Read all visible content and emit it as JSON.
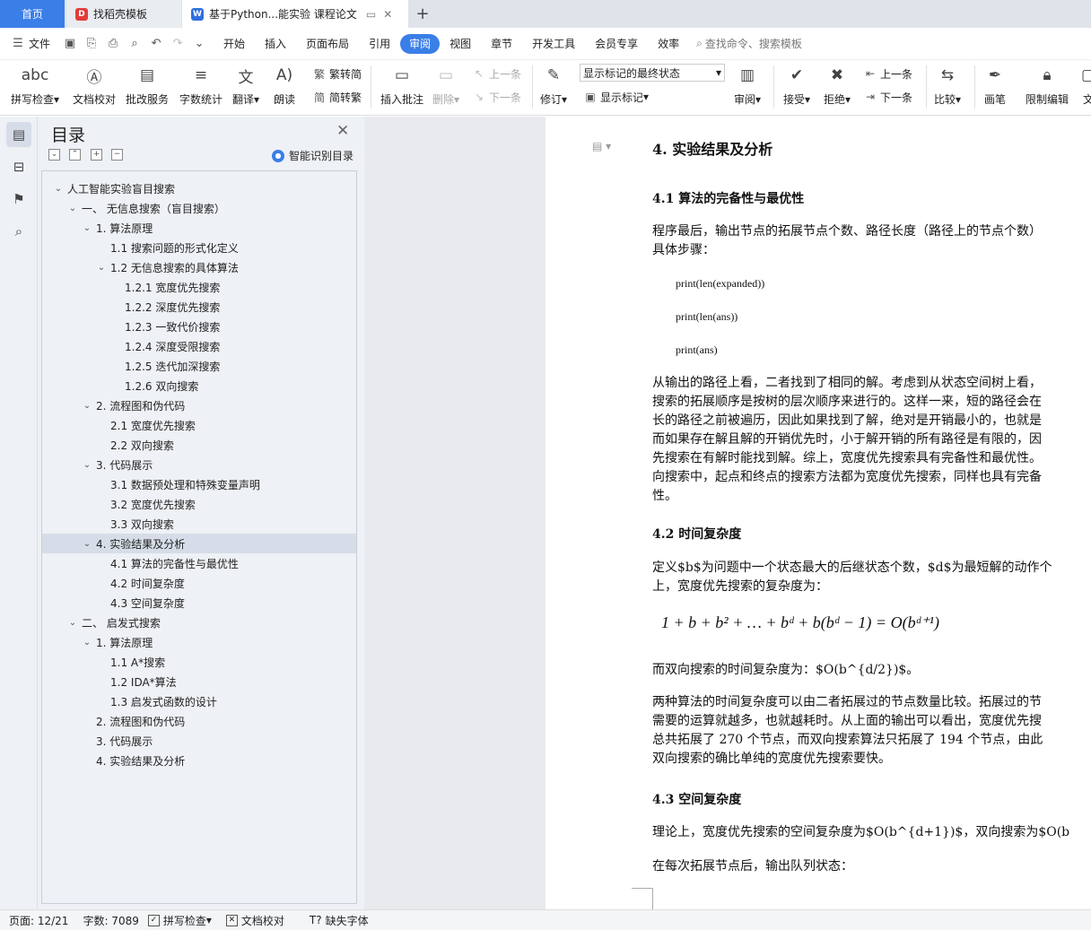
{
  "tabs": {
    "home": "首页",
    "template": "找稻壳模板",
    "doc": "基于Python...能实验 课程论文",
    "add": "+"
  },
  "menu": {
    "file": "文件",
    "items": [
      "开始",
      "插入",
      "页面布局",
      "引用",
      "审阅",
      "视图",
      "章节",
      "开发工具",
      "会员专享",
      "效率"
    ],
    "active": "审阅",
    "search": "查找命令、搜索模板"
  },
  "ribbon": {
    "spellcheck": "拼写检查",
    "proofread": "文档校对",
    "review_service": "批改服务",
    "word_count": "字数统计",
    "translate": "翻译",
    "read_aloud": "朗读",
    "trad_to_simp": "繁转简",
    "simp_to_trad": "简转繁",
    "insert_comment": "插入批注",
    "delete": "删除",
    "prev": "上一条",
    "next": "下一条",
    "track": "修订",
    "markup_state": "显示标记的最终状态",
    "show_markup": "显示标记",
    "review": "审阅",
    "accept": "接受",
    "reject": "拒绝",
    "prev2": "上一条",
    "next2": "下一条",
    "compare": "比较",
    "pen": "画笔",
    "restrict": "限制编辑",
    "more": "文"
  },
  "toc": {
    "title": "目录",
    "smart": "智能识别目录",
    "items": [
      {
        "text": "人工智能实验盲目搜索",
        "indent": 0,
        "caret": true
      },
      {
        "text": "一、  无信息搜索（盲目搜索）",
        "indent": 1,
        "caret": true
      },
      {
        "text": "1. 算法原理",
        "indent": 2,
        "caret": true
      },
      {
        "text": "1.1  搜索问题的形式化定义",
        "indent": 3,
        "caret": false
      },
      {
        "text": "1.2  无信息搜索的具体算法",
        "indent": 3,
        "caret": true
      },
      {
        "text": "1.2.1  宽度优先搜索",
        "indent": 4,
        "caret": false
      },
      {
        "text": "1.2.2  深度优先搜索",
        "indent": 4,
        "caret": false
      },
      {
        "text": "1.2.3  一致代价搜索",
        "indent": 4,
        "caret": false
      },
      {
        "text": "1.2.4  深度受限搜索",
        "indent": 4,
        "caret": false
      },
      {
        "text": "1.2.5  迭代加深搜索",
        "indent": 4,
        "caret": false
      },
      {
        "text": "1.2.6  双向搜索",
        "indent": 4,
        "caret": false
      },
      {
        "text": "2. 流程图和伪代码",
        "indent": 2,
        "caret": true
      },
      {
        "text": "2.1  宽度优先搜索",
        "indent": 3,
        "caret": false
      },
      {
        "text": "2.2  双向搜索",
        "indent": 3,
        "caret": false
      },
      {
        "text": "3. 代码展示",
        "indent": 2,
        "caret": true
      },
      {
        "text": "3.1  数据预处理和特殊变量声明",
        "indent": 3,
        "caret": false
      },
      {
        "text": "3.2  宽度优先搜索",
        "indent": 3,
        "caret": false
      },
      {
        "text": "3.3  双向搜索",
        "indent": 3,
        "caret": false
      },
      {
        "text": "4. 实验结果及分析",
        "indent": 2,
        "caret": true,
        "selected": true
      },
      {
        "text": "4.1  算法的完备性与最优性",
        "indent": 3,
        "caret": false
      },
      {
        "text": "4.2  时间复杂度",
        "indent": 3,
        "caret": false
      },
      {
        "text": "4.3  空间复杂度",
        "indent": 3,
        "caret": false
      },
      {
        "text": "二、  启发式搜索",
        "indent": 1,
        "caret": true
      },
      {
        "text": "1. 算法原理",
        "indent": 2,
        "caret": true
      },
      {
        "text": "1.1 A*搜索",
        "indent": 3,
        "caret": false
      },
      {
        "text": "1.2 IDA*算法",
        "indent": 3,
        "caret": false
      },
      {
        "text": "1.3  启发式函数的设计",
        "indent": 3,
        "caret": false
      },
      {
        "text": "2. 流程图和伪代码",
        "indent": 2,
        "caret": false
      },
      {
        "text": "3. 代码展示",
        "indent": 2,
        "caret": false
      },
      {
        "text": "4. 实验结果及分析",
        "indent": 2,
        "caret": false
      }
    ]
  },
  "doc": {
    "h4": "4.  实验结果及分析",
    "h41": "4.1  算法的完备性与最优性",
    "p1a": "程序最后，输出节点的拓展节点个数、路径长度（路径上的节点个数）",
    "p1b": "具体步骤：",
    "code1": "print(len(expanded))",
    "code2": "print(len(ans))",
    "code3": "print(ans)",
    "p2": [
      "从输出的路径上看，二者找到了相同的解。考虑到从状态空间树上看，",
      "搜索的拓展顺序是按树的层次顺序来进行的。这样一来，短的路径会在",
      "长的路径之前被遍历，因此如果找到了解，绝对是开销最小的，也就是",
      "而如果存在解且解的开销优先时，小于解开销的所有路径是有限的，因",
      "先搜索在有解时能找到解。综上，宽度优先搜索具有完备性和最优性。",
      "向搜索中，起点和终点的搜索方法都为宽度优先搜索，同样也具有完备",
      "性。"
    ],
    "h42": "4.2  时间复杂度",
    "p3a": "定义$b$为问题中一个状态最大的后继状态个数，$d$为最短解的动作个",
    "p3b": "上，宽度优先搜索的复杂度为：",
    "formula": "1 + b + b² + … + bᵈ + b(bᵈ − 1) = O(bᵈ⁺¹)",
    "p4": "而双向搜索的时间复杂度为：$O(b^{d/2})$。",
    "p5": [
      "两种算法的时间复杂度可以由二者拓展过的节点数量比较。拓展过的节",
      "需要的运算就越多，也就越耗时。从上面的输出可以看出，宽度优先搜",
      "总共拓展了  270  个节点，而双向搜索算法只拓展了  194  个节点，由此",
      "双向搜索的确比单纯的宽度优先搜索要快。"
    ],
    "h43": "4.3  空间复杂度",
    "p6": "理论上，宽度优先搜索的空间复杂度为$O(b^{d+1})$，双向搜索为$O(b",
    "p7": "在每次拓展节点后，输出队列状态："
  },
  "status": {
    "page": "页面: 12/21",
    "words": "字数: 7089",
    "spell": "拼写检查",
    "proof": "文档校对",
    "font": "缺失字体"
  },
  "colors": {
    "accent": "#3a7ee8"
  }
}
